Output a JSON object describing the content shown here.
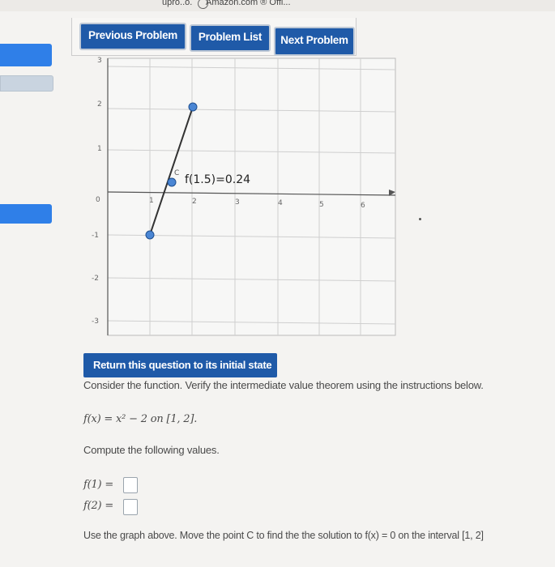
{
  "browser": {
    "bookmark_left": "upro..o.",
    "bookmark_amazon": "Amazon.com",
    "bookmark_office": "Offi..."
  },
  "nav": {
    "previous_label": "Previous Problem",
    "list_label": "Problem List",
    "next_label": "Next Problem"
  },
  "graph": {
    "x_ticks": [
      "0",
      "1",
      "2",
      "3",
      "4",
      "5",
      "6"
    ],
    "y_ticks": [
      "3",
      "2",
      "1",
      "-1",
      "-2",
      "-3"
    ],
    "point_label": "f(1.5)=0.24",
    "c_label": "C",
    "segment_color": "#333333",
    "point_fill": "#4a86d4"
  },
  "question": {
    "reset_label": "Return this question to its initial state",
    "intro": "Consider the function. Verify the intermediate value theorem using the instructions below.",
    "function_text": "f(x) = x² − 2 on [1, 2].",
    "compute_label": "Compute the following values.",
    "f1_label": "f(1) =",
    "f2_label": "f(2) =",
    "f1_value": "",
    "f2_value": "",
    "instruction": "Use the graph above. Move the point C to find the the solution to f(x) = 0 on the interval [1, 2]"
  }
}
